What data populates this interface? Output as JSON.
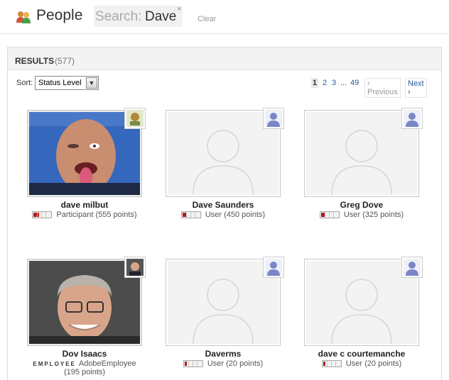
{
  "header": {
    "title": "People",
    "search_label": "Search:",
    "search_value": "Dave",
    "clear_search_glyph": "×",
    "clear_label": "Clear"
  },
  "results": {
    "label": "RESULTS",
    "count": "(577)"
  },
  "sort": {
    "label": "Sort:",
    "selected": "Status Level"
  },
  "pagination": {
    "pages": [
      "1",
      "2",
      "3"
    ],
    "current": "1",
    "ellipsis": "...",
    "last": "49",
    "prev": "‹ Previous",
    "next": "Next ›"
  },
  "people": [
    {
      "name": "dave milbut",
      "status": "Participant (555 points)",
      "level": 0.33,
      "photo": "custom",
      "badge": "custom-avatar-icon"
    },
    {
      "name": "Dave Saunders",
      "status": "User (450 points)",
      "level": 0.25,
      "photo": "placeholder",
      "badge": "default-user-icon"
    },
    {
      "name": "Greg Dove",
      "status": "User (325 points)",
      "level": 0.2,
      "photo": "placeholder",
      "badge": "default-user-icon"
    },
    {
      "name": "Dov Isaacs",
      "employee_tag": "EMPLOYEE",
      "status": "AdobeEmployee",
      "points": "(195 points)",
      "level": 0,
      "photo": "custom",
      "badge": "custom-avatar-icon"
    },
    {
      "name": "Daverms",
      "status": "User (20 points)",
      "level": 0.1,
      "photo": "placeholder",
      "badge": "default-user-icon"
    },
    {
      "name": "dave c courtemanche",
      "status": "User (20 points)",
      "level": 0.1,
      "photo": "placeholder",
      "badge": "default-user-icon"
    }
  ],
  "colors": {
    "meter_fill": "#b01c1c",
    "link": "#2a5a9a"
  }
}
